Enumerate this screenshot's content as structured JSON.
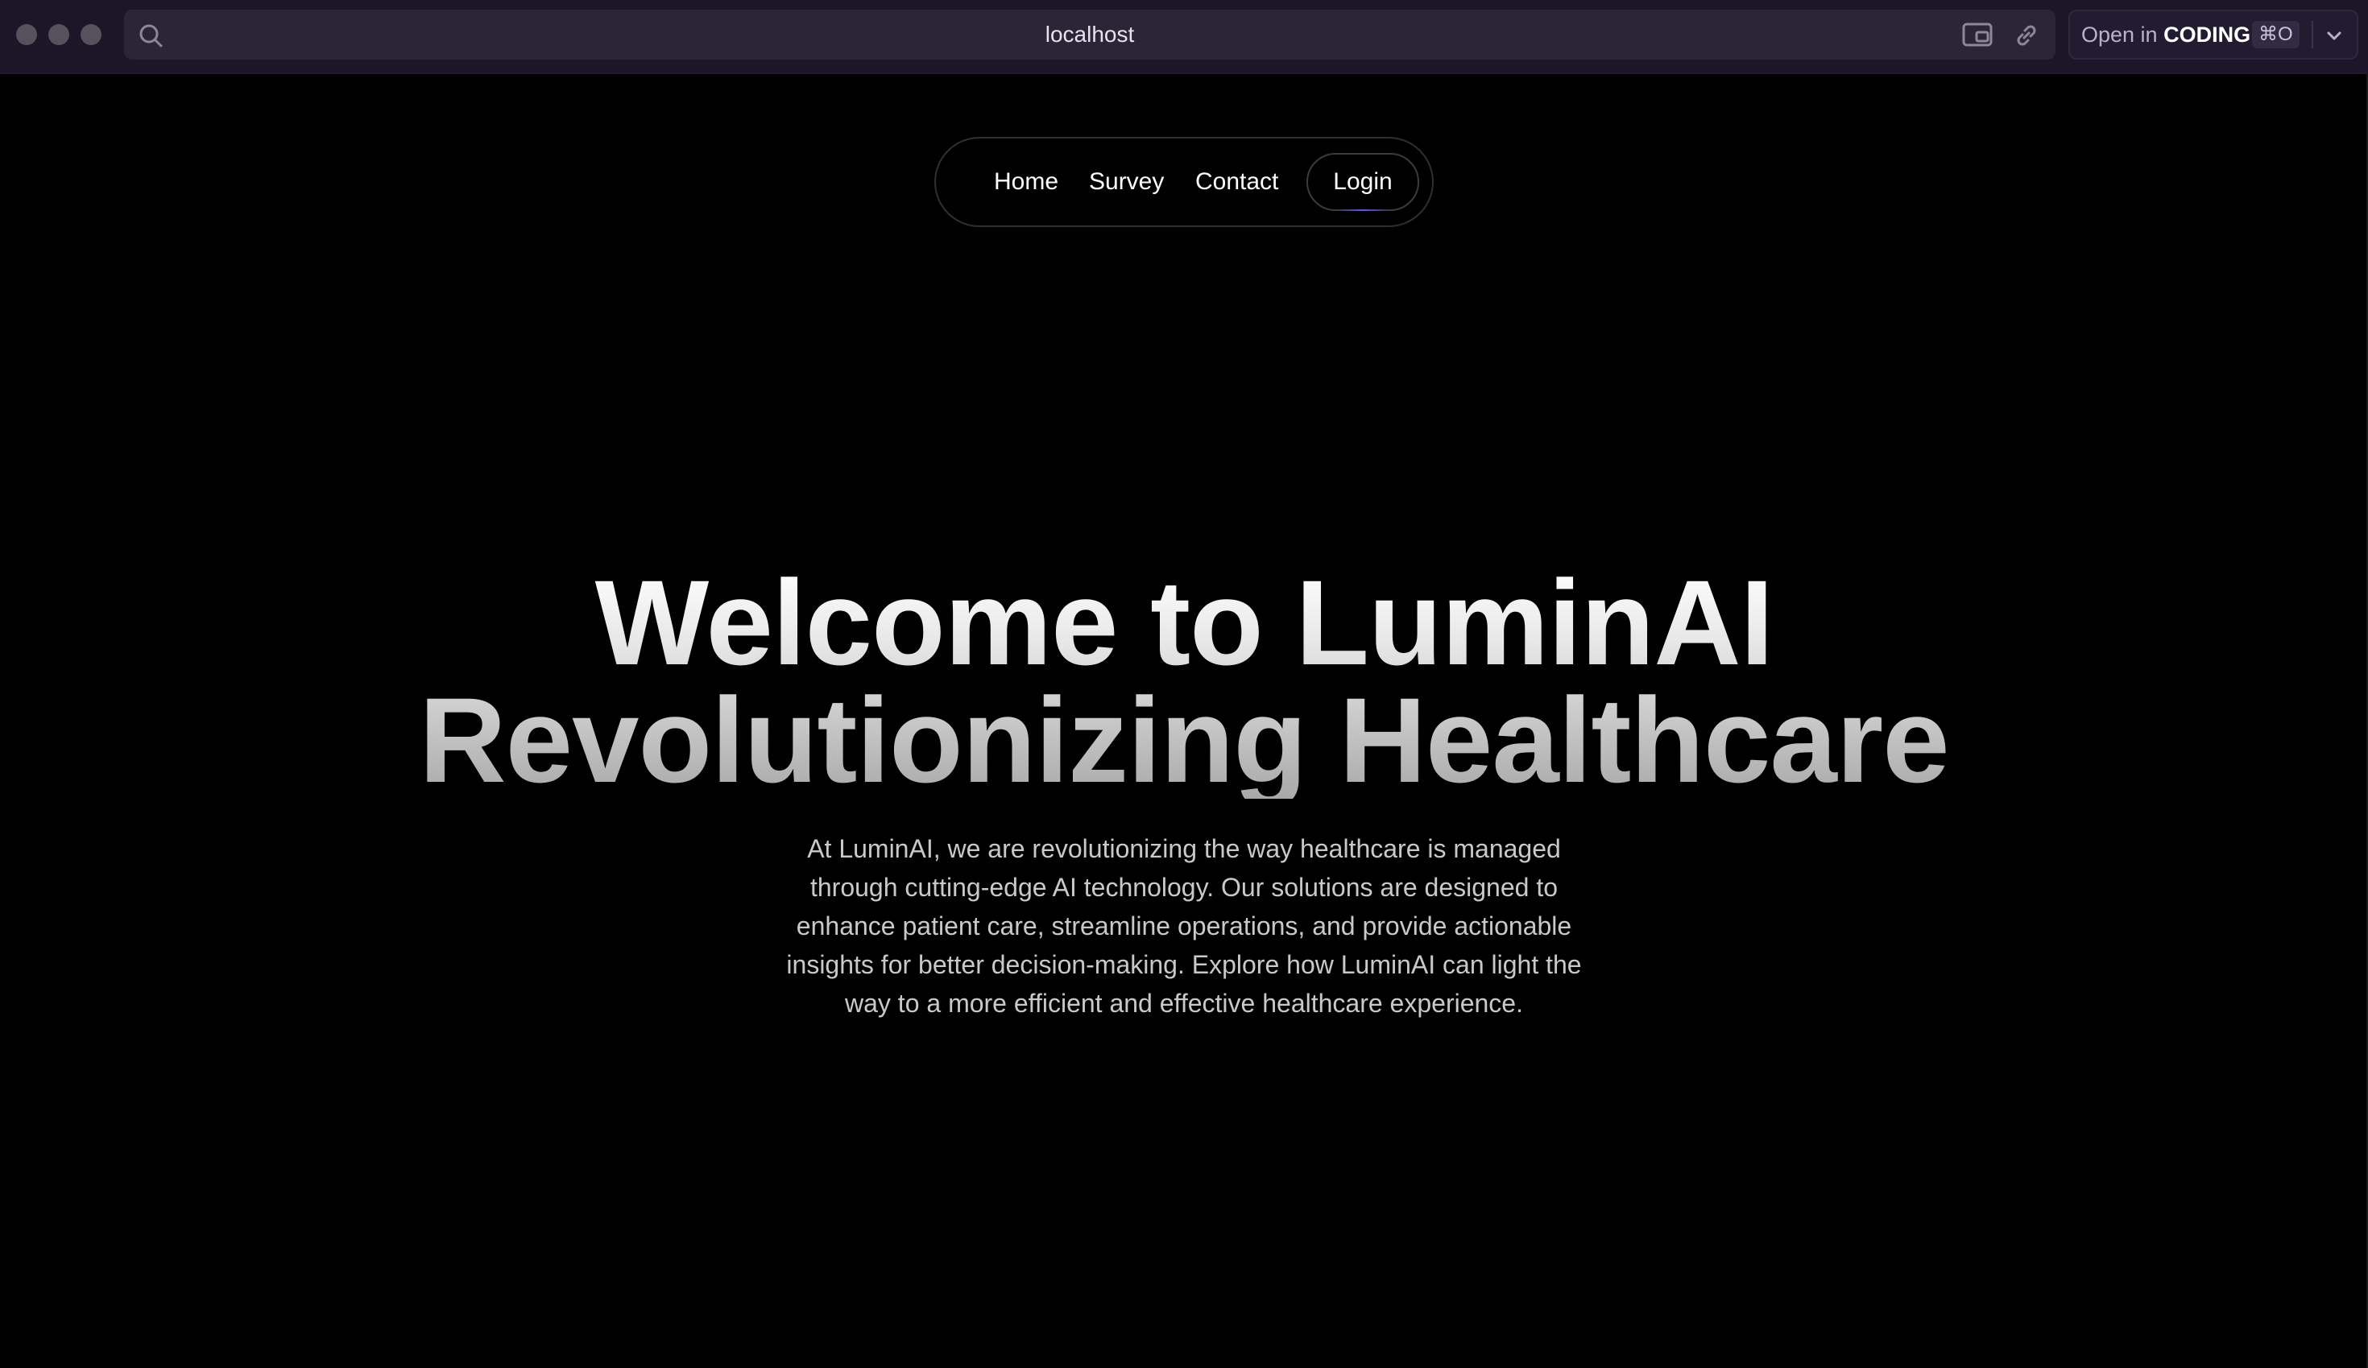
{
  "browser": {
    "url": "localhost",
    "open_in": {
      "prefix": "Open in",
      "app": "CODING",
      "shortcut": "⌘O"
    }
  },
  "nav": {
    "items": [
      {
        "label": "Home"
      },
      {
        "label": "Survey"
      },
      {
        "label": "Contact"
      }
    ],
    "login_label": "Login"
  },
  "hero": {
    "title_line1": "Welcome to LuminAI",
    "title_line2": "Revolutionizing Healthcare",
    "description": "At LuminAI, we are revolutionizing the way healthcare is managed through cutting-edge AI technology. Our solutions are designed to enhance patient care, streamline operations, and provide actionable insights for better decision-making. Explore how LuminAI can light the way to a more efficient and effective healthcare experience."
  },
  "icons": {
    "url_search": "search-icon",
    "url_action_a": "pip-icon",
    "url_action_b": "link-icon",
    "open_in_menu": "chevron-down-icon"
  }
}
